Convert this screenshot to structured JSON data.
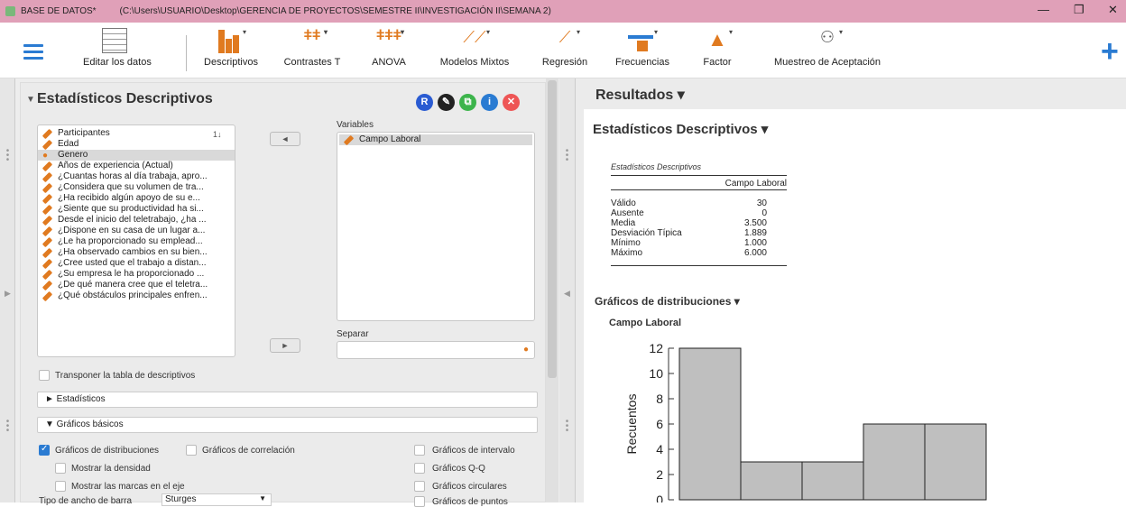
{
  "window": {
    "title_app": "BASE DE DATOS*",
    "title_path": "(C:\\Users\\USUARIO\\Desktop\\GERENCIA DE PROYECTOS\\SEMESTRE II\\INVESTIGACIÓN II\\SEMANA 2)",
    "min": "—",
    "restore": "❐",
    "close": "✕"
  },
  "toolbar": {
    "edit": "Editar los datos",
    "descriptivos": "Descriptivos",
    "contrastes": "Contrastes T",
    "anova": "ANOVA",
    "mixtos": "Modelos Mixtos",
    "regresion": "Regresión",
    "frecuencias": "Frecuencias",
    "factor": "Factor",
    "muestreo": "Muestreo de Aceptación",
    "plus": "+"
  },
  "analysis": {
    "title": "Estadísticos Descriptivos",
    "icons": {
      "r": "R",
      "edit": "✎",
      "copy": "⧉",
      "info": "i",
      "close": "✕"
    },
    "variables_list": [
      "Participantes",
      "Edad",
      "Genero",
      "Años de experiencia (Actual)",
      "¿Cuantas horas al día trabaja, apro...",
      "¿Considera que su volumen de tra...",
      "¿Ha recibido algún apoyo de su e...",
      "¿Siente que su productividad ha si...",
      "Desde el inicio del teletrabajo, ¿ha ...",
      "¿Dispone en su casa de un lugar a...",
      "¿Le ha proporcionado su emplead...",
      "¿Ha observado cambios en su bien...",
      "¿Cree usted que el trabajo a distan...",
      "¿Su empresa le ha proporcionado ...",
      "¿De qué manera cree que el teletra...",
      "¿Qué obstáculos principales enfren..."
    ],
    "sort_icon": "1↓",
    "variables_label": "Variables",
    "selected_var": "Campo Laboral",
    "split_label": "Separar",
    "transpose": "Transponer la tabla de descriptivos",
    "sec_stats": "► Estadísticos",
    "sec_plots": "▼ Gráficos básicos",
    "opt_dist": "Gráficos de distribuciones",
    "opt_corr": "Gráficos de correlación",
    "opt_density": "Mostrar la densidad",
    "opt_rug": "Mostrar las marcas en el eje",
    "opt_interval": "Gráficos de intervalo",
    "opt_qq": "Gráficos Q-Q",
    "opt_pie": "Gráficos circulares",
    "opt_dot": "Gráficos de puntos",
    "bin_label": "Tipo de ancho de barra",
    "bin_value": "Sturges"
  },
  "results": {
    "header": "Resultados ▾",
    "section": "Estadísticos Descriptivos ▾",
    "table_caption": "Estadísticos Descriptivos",
    "col": "Campo Laboral",
    "rows": [
      [
        "Válido",
        "30"
      ],
      [
        "Ausente",
        "0"
      ],
      [
        "Media",
        "3.500"
      ],
      [
        "Desviación Típica",
        "1.889"
      ],
      [
        "Mínimo",
        "1.000"
      ],
      [
        "Máximo",
        "6.000"
      ]
    ],
    "plots_header": "Gráficos de distribuciones ▾",
    "plot_title": "Campo Laboral"
  },
  "chart_data": {
    "type": "bar",
    "title": "Campo Laboral",
    "ylabel": "Recuentos",
    "yticks": [
      0,
      2,
      4,
      6,
      8,
      10,
      12
    ],
    "ylim": [
      0,
      12
    ],
    "values": [
      12,
      3,
      3,
      6,
      6
    ]
  }
}
